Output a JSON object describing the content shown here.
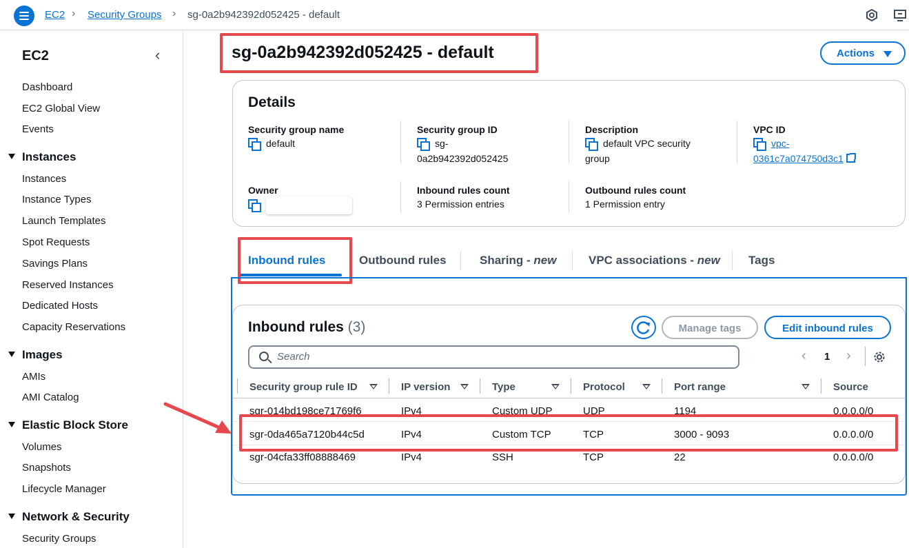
{
  "breadcrumb": {
    "root": "EC2",
    "section": "Security Groups",
    "current": "sg-0a2b942392d052425 - default"
  },
  "sidebar": {
    "title": "EC2",
    "top_items": [
      "Dashboard",
      "EC2 Global View",
      "Events"
    ],
    "sections": [
      {
        "name": "Instances",
        "items": [
          "Instances",
          "Instance Types",
          "Launch Templates",
          "Spot Requests",
          "Savings Plans",
          "Reserved Instances",
          "Dedicated Hosts",
          "Capacity Reservations"
        ]
      },
      {
        "name": "Images",
        "items": [
          "AMIs",
          "AMI Catalog"
        ]
      },
      {
        "name": "Elastic Block Store",
        "items": [
          "Volumes",
          "Snapshots",
          "Lifecycle Manager"
        ]
      },
      {
        "name": "Network & Security",
        "items": [
          "Security Groups"
        ]
      }
    ]
  },
  "page": {
    "title": "sg-0a2b942392d052425 - default",
    "actions_label": "Actions"
  },
  "details": {
    "heading": "Details",
    "sg_name_label": "Security group name",
    "sg_name": "default",
    "sg_id_label": "Security group ID",
    "sg_id_line1": "sg-",
    "sg_id_line2": "0a2b942392d052425",
    "description_label": "Description",
    "description_line1": "default VPC security",
    "description_line2": "group",
    "vpc_label": "VPC ID",
    "vpc_line1": "vpc-",
    "vpc_line2": "0361c7a074750d3c1",
    "owner_label": "Owner",
    "inbound_count_label": "Inbound rules count",
    "inbound_count": "3 Permission entries",
    "outbound_count_label": "Outbound rules count",
    "outbound_count": "1 Permission entry"
  },
  "tabs": {
    "inbound": "Inbound rules",
    "outbound": "Outbound rules",
    "sharing": "Sharing - ",
    "sharing_new": "new",
    "vpc_assoc": "VPC associations - ",
    "vpc_assoc_new": "new",
    "tags": "Tags"
  },
  "rules": {
    "title": "Inbound rules",
    "count": "(3)",
    "manage_tags": "Manage tags",
    "edit": "Edit inbound rules",
    "search_placeholder": "Search",
    "page": "1",
    "columns": [
      "Security group rule ID",
      "IP version",
      "Type",
      "Protocol",
      "Port range",
      "Source"
    ],
    "rows": [
      [
        "sgr-014bd198ce71769f6",
        "IPv4",
        "Custom UDP",
        "UDP",
        "1194",
        "0.0.0.0/0"
      ],
      [
        "sgr-0da465a7120b44c5d",
        "IPv4",
        "Custom TCP",
        "TCP",
        "3000 - 9093",
        "0.0.0.0/0"
      ],
      [
        "sgr-04cfa33ff08888469",
        "IPv4",
        "SSH",
        "TCP",
        "22",
        "0.0.0.0/0"
      ]
    ]
  },
  "colors": {
    "accent": "#0972d3",
    "highlight": "#e5484d"
  }
}
